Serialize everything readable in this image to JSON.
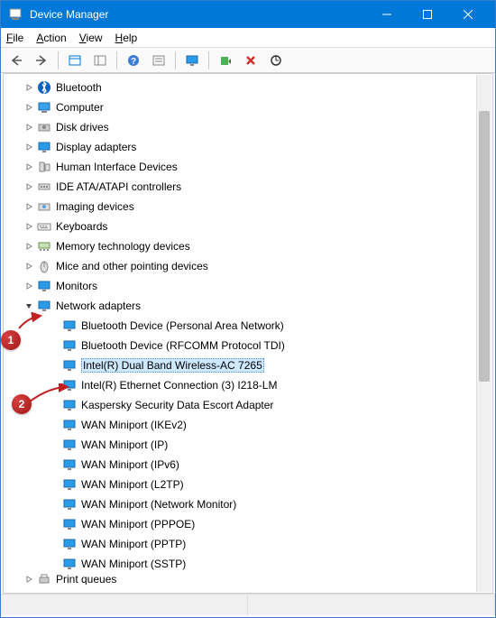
{
  "window": {
    "title": "Device Manager"
  },
  "menu": {
    "file": "File",
    "action": "Action",
    "view": "View",
    "help": "Help"
  },
  "toolbar_icons": {
    "back": "back",
    "forward": "forward",
    "show_hidden": "show-hidden",
    "treeview": "treeview",
    "help": "help",
    "properties": "properties",
    "monitor": "monitor",
    "update": "update-driver",
    "uninstall": "uninstall",
    "scan": "scan-hardware"
  },
  "categories": [
    {
      "label": "Bluetooth",
      "icon": "bluetooth",
      "expanded": false
    },
    {
      "label": "Computer",
      "icon": "computer",
      "expanded": false
    },
    {
      "label": "Disk drives",
      "icon": "disk",
      "expanded": false
    },
    {
      "label": "Display adapters",
      "icon": "display",
      "expanded": false
    },
    {
      "label": "Human Interface Devices",
      "icon": "hid",
      "expanded": false
    },
    {
      "label": "IDE ATA/ATAPI controllers",
      "icon": "ide",
      "expanded": false
    },
    {
      "label": "Imaging devices",
      "icon": "imaging",
      "expanded": false
    },
    {
      "label": "Keyboards",
      "icon": "keyboard",
      "expanded": false
    },
    {
      "label": "Memory technology devices",
      "icon": "memory",
      "expanded": false
    },
    {
      "label": "Mice and other pointing devices",
      "icon": "mouse",
      "expanded": false
    },
    {
      "label": "Monitors",
      "icon": "monitor",
      "expanded": false
    },
    {
      "label": "Network adapters",
      "icon": "network",
      "expanded": true
    },
    {
      "label": "Print queues",
      "icon": "printer",
      "expanded": false,
      "truncated": true
    }
  ],
  "network_children": [
    {
      "label": "Bluetooth Device (Personal Area Network)",
      "selected": false
    },
    {
      "label": "Bluetooth Device (RFCOMM Protocol TDI)",
      "selected": false
    },
    {
      "label": "Intel(R) Dual Band Wireless-AC 7265",
      "selected": true
    },
    {
      "label": "Intel(R) Ethernet Connection (3) I218-LM",
      "selected": false
    },
    {
      "label": "Kaspersky Security Data Escort Adapter",
      "selected": false
    },
    {
      "label": "WAN Miniport (IKEv2)",
      "selected": false
    },
    {
      "label": "WAN Miniport (IP)",
      "selected": false
    },
    {
      "label": "WAN Miniport (IPv6)",
      "selected": false
    },
    {
      "label": "WAN Miniport (L2TP)",
      "selected": false
    },
    {
      "label": "WAN Miniport (Network Monitor)",
      "selected": false
    },
    {
      "label": "WAN Miniport (PPPOE)",
      "selected": false
    },
    {
      "label": "WAN Miniport (PPTP)",
      "selected": false
    },
    {
      "label": "WAN Miniport (SSTP)",
      "selected": false
    }
  ],
  "callouts": {
    "one": "1",
    "two": "2"
  }
}
